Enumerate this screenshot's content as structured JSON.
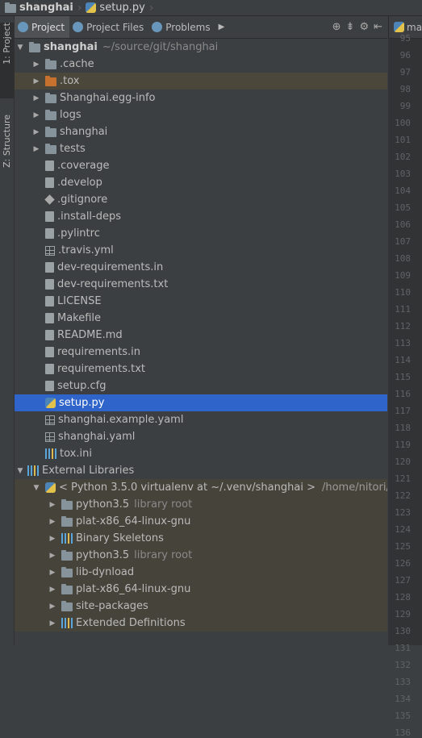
{
  "breadcrumb": {
    "project": "shanghai",
    "file": "setup.py"
  },
  "strip": {
    "project_label": "1: Project",
    "structure_label": "Z: Structure"
  },
  "toolwindow": {
    "tabs": [
      {
        "label": "Project",
        "active": true
      },
      {
        "label": "Project Files",
        "active": false
      },
      {
        "label": "Problems",
        "active": false
      }
    ]
  },
  "editor": {
    "tab_label": "ma"
  },
  "tree": {
    "root": {
      "name": "shanghai",
      "path": "~/source/git/shanghai"
    },
    "items": [
      {
        "label": ".cache",
        "icon": "folder-icon",
        "expandable": true
      },
      {
        "label": ".tox",
        "icon": "folder-excluded-icon",
        "expandable": true
      },
      {
        "label": "Shanghai.egg-info",
        "icon": "folder-icon",
        "expandable": true
      },
      {
        "label": "logs",
        "icon": "folder-icon",
        "expandable": true
      },
      {
        "label": "shanghai",
        "icon": "package-icon",
        "expandable": true
      },
      {
        "label": "tests",
        "icon": "folder-icon",
        "expandable": true
      },
      {
        "label": ".coverage",
        "icon": "file-icon"
      },
      {
        "label": ".develop",
        "icon": "file-unknown-icon"
      },
      {
        "label": ".gitignore",
        "icon": "git-icon"
      },
      {
        "label": ".install-deps",
        "icon": "file-unknown-icon"
      },
      {
        "label": ".pylintrc",
        "icon": "file-unknown-icon"
      },
      {
        "label": ".travis.yml",
        "icon": "yaml-icon"
      },
      {
        "label": "dev-requirements.in",
        "icon": "file-icon"
      },
      {
        "label": "dev-requirements.txt",
        "icon": "file-icon"
      },
      {
        "label": "LICENSE",
        "icon": "file-icon"
      },
      {
        "label": "Makefile",
        "icon": "file-icon"
      },
      {
        "label": "README.md",
        "icon": "file-icon"
      },
      {
        "label": "requirements.in",
        "icon": "file-icon"
      },
      {
        "label": "requirements.txt",
        "icon": "file-icon"
      },
      {
        "label": "setup.cfg",
        "icon": "file-icon"
      },
      {
        "label": "setup.py",
        "icon": "python-file-icon",
        "selected": true
      },
      {
        "label": "shanghai.example.yaml",
        "icon": "yaml-icon"
      },
      {
        "label": "shanghai.yaml",
        "icon": "yaml-icon"
      },
      {
        "label": "tox.ini",
        "icon": "ini-icon"
      }
    ],
    "external": {
      "label": "External Libraries",
      "sdk": {
        "label": "< Python 3.5.0 virtualenv at ~/.venv/shanghai >",
        "path": "/home/nitori/."
      },
      "children": [
        {
          "label": "python3.5",
          "hint": "library root",
          "icon": "folder-icon"
        },
        {
          "label": "plat-x86_64-linux-gnu",
          "hint": "",
          "icon": "folder-icon"
        },
        {
          "label": "Binary Skeletons",
          "hint": "",
          "icon": "library-icon"
        },
        {
          "label": "python3.5",
          "hint": "library root",
          "icon": "folder-icon"
        },
        {
          "label": "lib-dynload",
          "hint": "",
          "icon": "folder-icon"
        },
        {
          "label": "plat-x86_64-linux-gnu",
          "hint": "",
          "icon": "folder-icon"
        },
        {
          "label": "site-packages",
          "hint": "",
          "icon": "folder-icon"
        },
        {
          "label": "Extended Definitions",
          "hint": "",
          "icon": "library-icon"
        }
      ]
    }
  },
  "gutter": {
    "lines": [
      "95",
      "96",
      "97",
      "98",
      "99",
      "100",
      "101",
      "102",
      "103",
      "104",
      "105",
      "106",
      "107",
      "108",
      "109",
      "110",
      "111",
      "112",
      "113",
      "114",
      "115",
      "116",
      "117",
      "118",
      "119",
      "120",
      "121",
      "122",
      "123",
      "124",
      "125",
      "126",
      "127",
      "128",
      "129",
      "130",
      "131",
      "132",
      "133",
      "134",
      "135",
      "136"
    ]
  },
  "colors": {
    "selection": "#2f65ca",
    "background": "#3c3f41",
    "excluded_folder": "#c6722e"
  }
}
